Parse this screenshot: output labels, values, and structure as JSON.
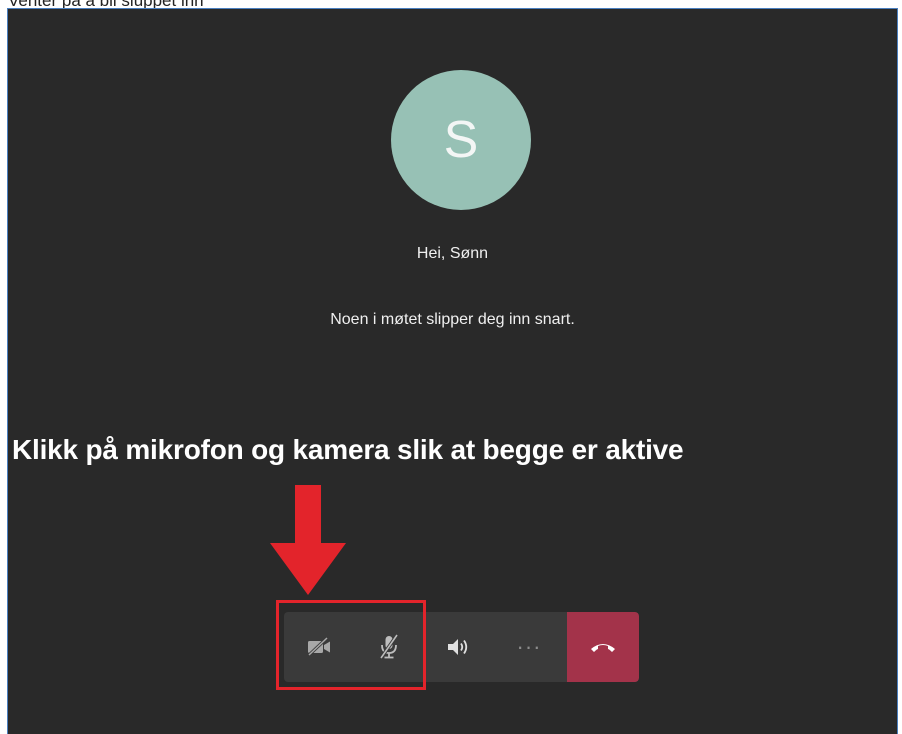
{
  "page": {
    "top_caption": "Venter på å bli sluppet inn",
    "greeting": "Hei, Sønn",
    "waiting_message": "Noen i møtet slipper deg inn snart.",
    "instruction": "Klikk på mikrofon og kamera slik at begge er aktive"
  },
  "avatar": {
    "initial": "S",
    "color": "#97c1b5"
  },
  "toolbar": {
    "buttons": [
      {
        "name": "camera-toggle",
        "icon": "camera-off-icon",
        "state": "off"
      },
      {
        "name": "microphone-toggle",
        "icon": "microphone-off-icon",
        "state": "off"
      },
      {
        "name": "speaker",
        "icon": "speaker-icon"
      },
      {
        "name": "more-options",
        "icon": "more-icon",
        "label": "···"
      },
      {
        "name": "hang-up",
        "icon": "hang-up-icon",
        "color": "#a3334a"
      }
    ]
  },
  "annotation": {
    "arrow_color": "#e3242b",
    "highlight_color": "#e3242b"
  }
}
